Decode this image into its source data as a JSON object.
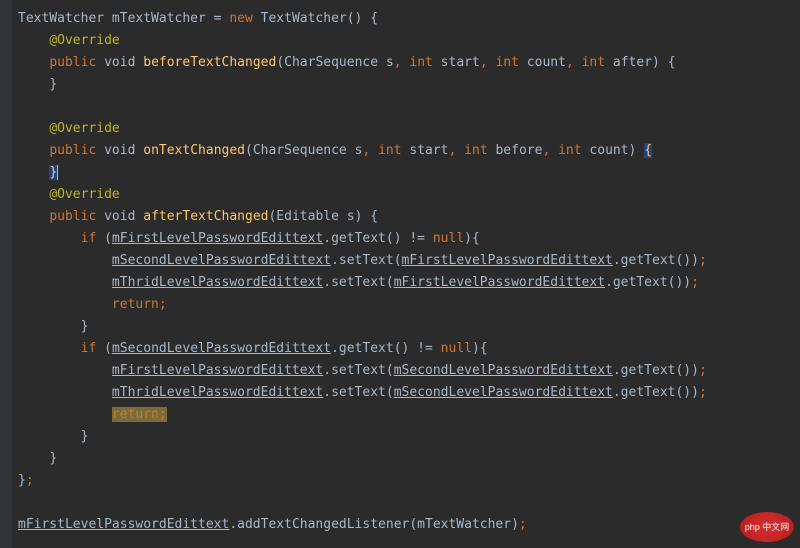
{
  "code": {
    "l1_a": "TextWatcher mTextWatcher = ",
    "l1_b": "new",
    "l1_c": " TextWatcher() {",
    "l2": "@Override",
    "l3_a": "public",
    "l3_b": " void ",
    "l3_c": "beforeTextChanged",
    "l3_d": "(CharSequence s",
    "l3_e": "int",
    "l3_f": " start",
    "l3_g": " count",
    "l3_h": " after) {",
    "l4": "}",
    "l5": "@Override",
    "l6_a": "public",
    "l6_b": " void ",
    "l6_c": "onTextChanged",
    "l6_d": "(CharSequence s",
    "l6_e": " start",
    "l6_f": " before",
    "l6_g": " count) ",
    "l6_h": "{",
    "l7_a": "}",
    "l8": "@Override",
    "l9_a": "public",
    "l9_b": " void ",
    "l9_c": "afterTextChanged",
    "l9_d": "(Editable s) {",
    "l10_a": "if",
    "l10_b": " (",
    "l10_c": "mFirstLevelPasswordEdittext",
    "l10_d": ".getText() != ",
    "l10_e": "null",
    "l10_f": "){",
    "l11_a": "mSecondLevelPasswordEdittext",
    "l11_b": ".setText(",
    "l11_c": "mFirstLevelPasswordEdittext",
    "l11_d": ".getText())",
    "l12_a": "mThridLevelPasswordEdittext",
    "l12_b": ".setText(",
    "l12_c": "mFirstLevelPasswordEdittext",
    "l12_d": ".getText())",
    "l13": "return",
    "l14": "}",
    "l15_a": "if",
    "l15_b": " (",
    "l15_c": "mSecondLevelPasswordEdittext",
    "l15_d": ".getText() != ",
    "l15_e": "null",
    "l15_f": "){",
    "l16_a": "mFirstLevelPasswordEdittext",
    "l16_b": ".setText(",
    "l16_c": "mSecondLevelPasswordEdittext",
    "l16_d": ".getText())",
    "l17_a": "mThridLevelPasswordEdittext",
    "l17_b": ".setText(",
    "l17_c": "mSecondLevelPasswordEdittext",
    "l17_d": ".getText())",
    "l18": "return",
    "l19": "}",
    "l20": "}",
    "l21": "}",
    "l22_a": "mFirstLevelPasswordEdittext",
    "l22_b": ".addTextChangedListener(mTextWatcher)",
    "semi": ";",
    "comma": ", ",
    "int": "int"
  },
  "logo": "php 中文网"
}
